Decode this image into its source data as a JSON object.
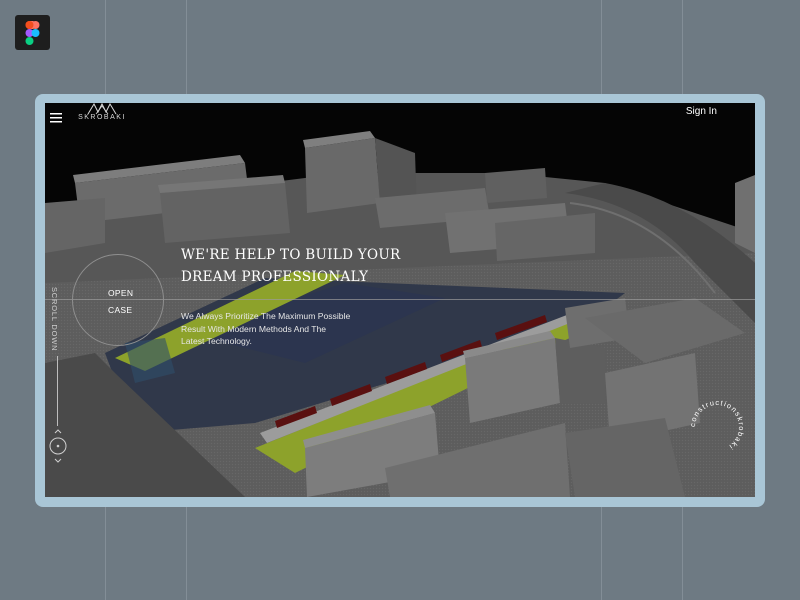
{
  "header": {
    "logo_text": "SKROBAKI",
    "signin_label": "Sign In"
  },
  "hero": {
    "title_line1": "WE'RE HELP TO BUILD YOUR",
    "title_line2": "DREAM PROFESSIONALY",
    "subtitle_line1": "We Always Prioritize The Maximum Possible",
    "subtitle_line2": "Result With Modern Methods And The",
    "subtitle_line3": "Latest Technology."
  },
  "open_case": {
    "line1": "OPEN",
    "line2": "CASE"
  },
  "scroll": {
    "label": "SCROLL DOWN"
  },
  "badge": {
    "circular_text": "constructionskrobaki"
  },
  "colors": {
    "canvas_bg": "#6e7a83",
    "frame_border": "#a9c6d6",
    "accent_green": "#8da22b"
  },
  "icons": [
    "figma-icon",
    "menu-icon",
    "logo-icon",
    "chevron-up-icon",
    "chevron-down-icon",
    "scroll-dot-icon"
  ]
}
